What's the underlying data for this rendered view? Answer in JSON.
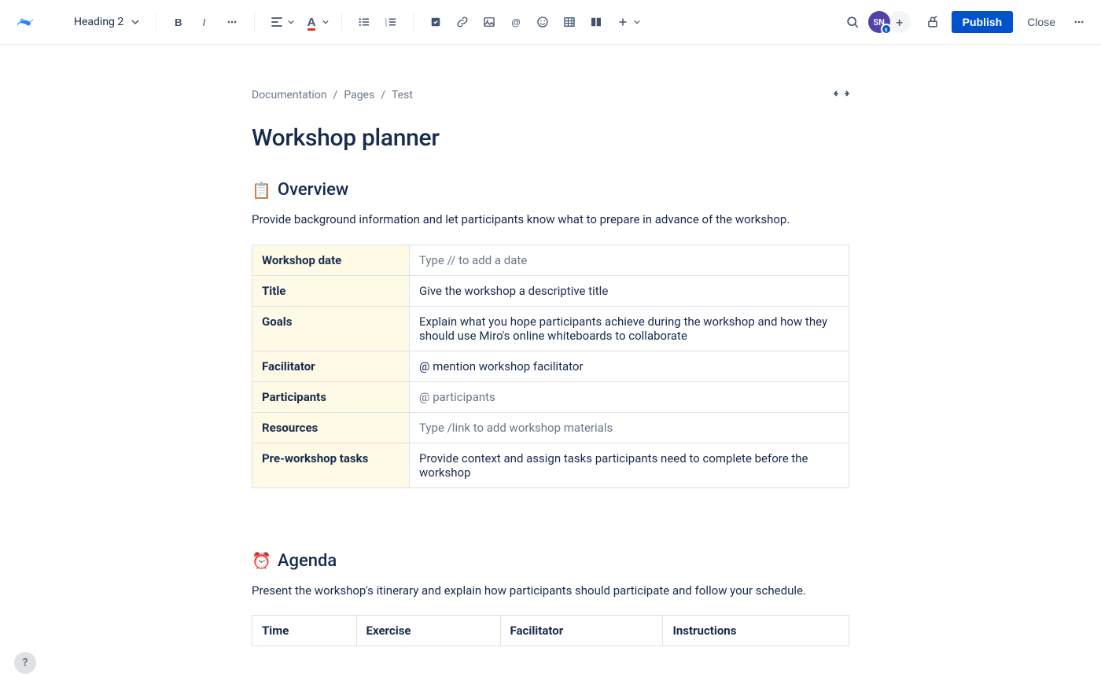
{
  "toolbar": {
    "heading_label": "Heading 2",
    "avatar_initials": "SN",
    "avatar_badge": "s",
    "publish_label": "Publish",
    "close_label": "Close"
  },
  "breadcrumbs": [
    "Documentation",
    "Pages",
    "Test"
  ],
  "page_title": "Workshop planner",
  "overview": {
    "emoji": "📋",
    "heading": "Overview",
    "description": "Provide background information and let participants know what to prepare in advance of the workshop.",
    "rows": [
      {
        "label": "Workshop date",
        "value": "Type // to add a date",
        "placeholder": true
      },
      {
        "label": "Title",
        "value": "Give the workshop a descriptive title",
        "placeholder": false
      },
      {
        "label": "Goals",
        "value": "Explain what you hope participants achieve during the workshop and how they should use Miro's online whiteboards to collaborate",
        "placeholder": false
      },
      {
        "label": "Facilitator",
        "value": "@ mention workshop facilitator",
        "placeholder": false
      },
      {
        "label": "Participants",
        "value": "@ participants",
        "placeholder": true
      },
      {
        "label": "Resources",
        "value": "Type /link to add workshop materials",
        "placeholder": true
      },
      {
        "label": "Pre-workshop tasks",
        "value": "Provide context and assign tasks participants need to complete before the workshop",
        "placeholder": false
      }
    ]
  },
  "agenda": {
    "emoji": "⏰",
    "heading": "Agenda",
    "description": "Present the workshop's itinerary and explain how participants should participate and follow your schedule.",
    "columns": [
      "Time",
      "Exercise",
      "Facilitator",
      "Instructions"
    ]
  }
}
